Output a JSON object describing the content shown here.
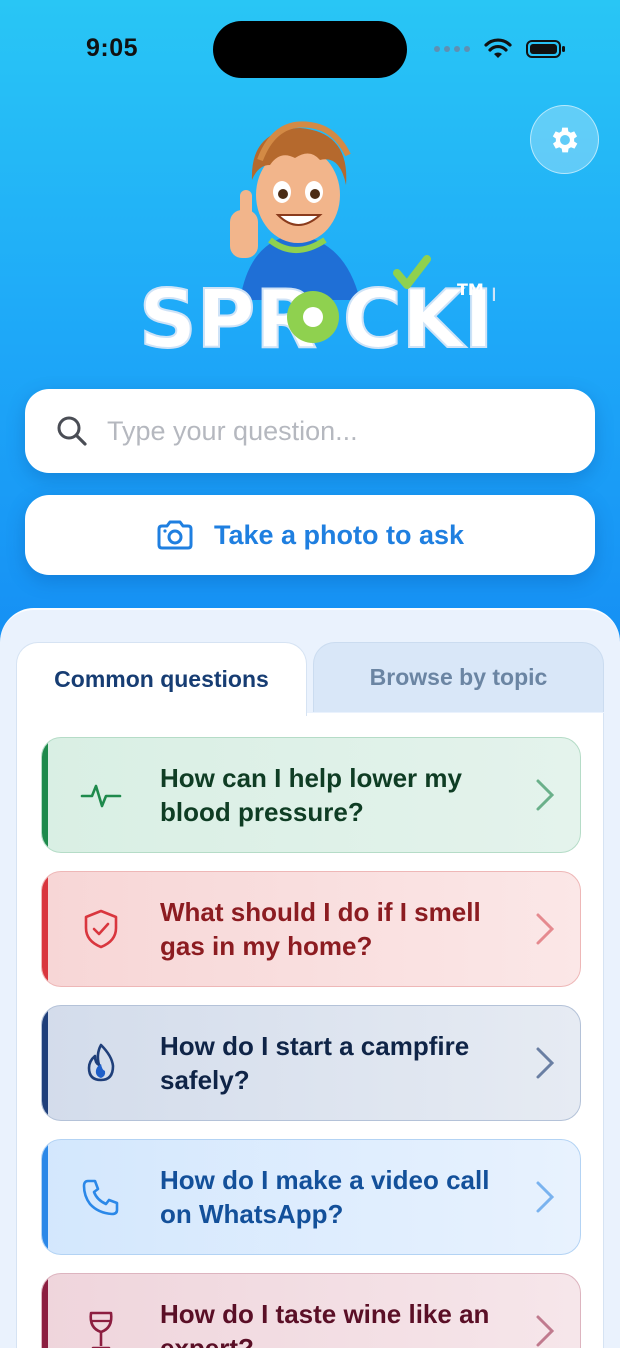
{
  "status": {
    "time": "9:05"
  },
  "brand": {
    "name": "SPROCKIT",
    "trademark": "TM"
  },
  "search": {
    "placeholder": "Type your question..."
  },
  "photo": {
    "label": "Take a photo to ask",
    "icon": "camera-icon"
  },
  "tabs": [
    {
      "label": "Common questions",
      "active": true
    },
    {
      "label": "Browse by topic",
      "active": false
    }
  ],
  "questions": [
    {
      "text": "How can I help lower my blood pressure?",
      "icon": "heartbeat-icon",
      "color": "#1e8a4c",
      "text_color": "#0f3d24"
    },
    {
      "text": "What should I do if I smell gas in my home?",
      "icon": "shield-check-icon",
      "color": "#d9363e",
      "text_color": "#8c1c21"
    },
    {
      "text": "How do I start a campfire safely?",
      "icon": "flame-icon",
      "color": "#1f3f7a",
      "text_color": "#0f2447"
    },
    {
      "text": "How do I make a video call on WhatsApp?",
      "icon": "phone-icon",
      "color": "#2b88e8",
      "text_color": "#13509a"
    },
    {
      "text": "How do I taste wine like an expert?",
      "icon": "wine-glass-icon",
      "color": "#8c1e40",
      "text_color": "#5a0f26"
    }
  ],
  "colors": {
    "accent": "#1f7fe0",
    "background_top": "#29c6f5",
    "background_bottom": "#1383f0"
  }
}
